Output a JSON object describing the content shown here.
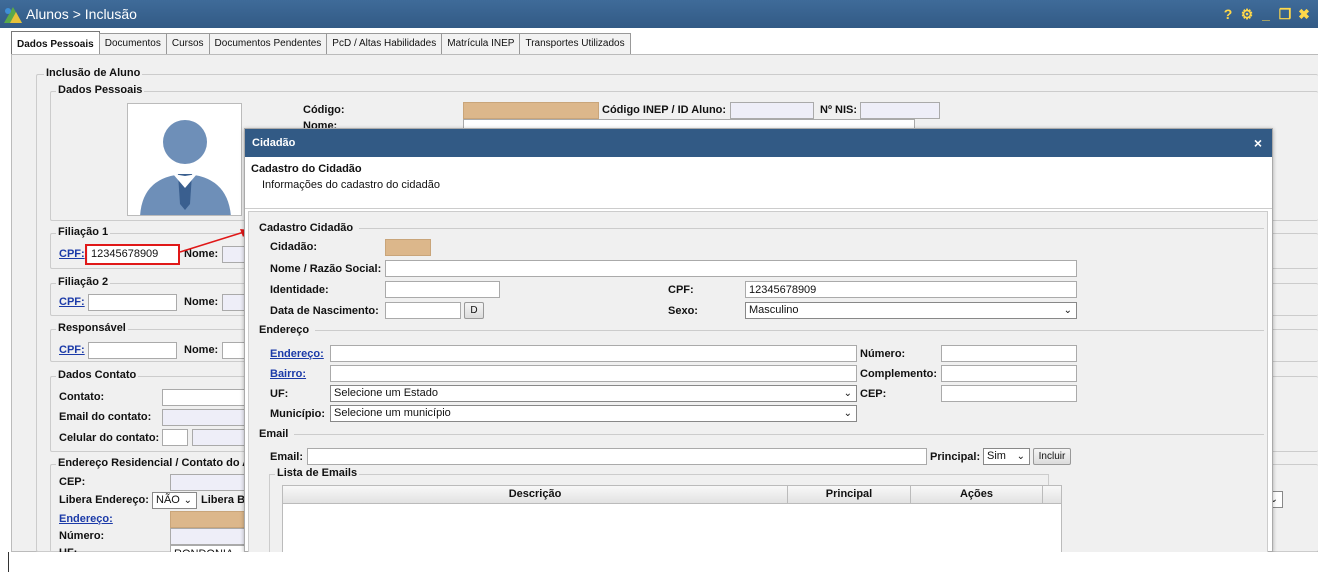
{
  "window": {
    "title": "Alunos > Inclusão",
    "accent": "#325a85"
  },
  "tabs": [
    {
      "label": "Dados Pessoais",
      "active": true
    },
    {
      "label": "Documentos"
    },
    {
      "label": "Cursos"
    },
    {
      "label": "Documentos Pendentes"
    },
    {
      "label": "PcD / Altas Habilidades"
    },
    {
      "label": "Matrícula INEP"
    },
    {
      "label": "Transportes Utilizados"
    }
  ],
  "form": {
    "section_title": "Inclusão de Aluno",
    "dados_pessoais": "Dados Pessoais",
    "codigo_label": "Código:",
    "inep_label": "Código INEP / ID Aluno:",
    "nis_label": "Nº NIS:",
    "nome_label": "Nome:",
    "filiacao1": "Filiação 1",
    "filiacao2": "Filiação 2",
    "responsavel": "Responsável",
    "cpf_label": "CPF:",
    "filiacao1_cpf": "12345678909",
    "dados_contato": "Dados Contato",
    "contato_label": "Contato:",
    "email_contato_label": "Email do contato:",
    "celular_contato_label": "Celular do contato:",
    "endereco_residencial": "Endereço Residencial / Contato do A",
    "cep_label": "CEP:",
    "libera_endereco_label": "Libera Endereço:",
    "libera_endereco_value": "NÃO",
    "libera_b_label": "Libera B",
    "endereco_link": "Endereço:",
    "numero_label": "Número:",
    "uf_label": "UF:",
    "uf_value": "RONDONIA"
  },
  "modal": {
    "title": "Cidadão",
    "close": "×",
    "subtitle": "Cadastro do Cidadão",
    "description": "Informações do cadastro do cidadão",
    "section_cadastro": "Cadastro Cidadão",
    "cidadao_label": "Cidadão:",
    "nome_label": "Nome / Razão Social:",
    "identidade_label": "Identidade:",
    "cpf_label": "CPF:",
    "cpf_value": "12345678909",
    "nascimento_label": "Data de Nascimento:",
    "date_button": "D",
    "sexo_label": "Sexo:",
    "sexo_value": "Masculino",
    "section_endereco": "Endereço",
    "endereco_link": "Endereço:",
    "numero_label": "Número:",
    "bairro_link": "Bairro:",
    "complemento_label": "Complemento:",
    "uf_label": "UF:",
    "uf_placeholder": "Selecione um Estado",
    "cep_label": "CEP:",
    "municipio_label": "Município:",
    "municipio_placeholder": "Selecione um município",
    "section_email": "Email",
    "email_label": "Email:",
    "principal_label": "Principal:",
    "principal_value": "Sim",
    "incluir_button": "Incluir",
    "lista_emails": "Lista de Emails",
    "grid_headers": {
      "descricao": "Descrição",
      "principal": "Principal",
      "acoes": "Ações"
    }
  }
}
